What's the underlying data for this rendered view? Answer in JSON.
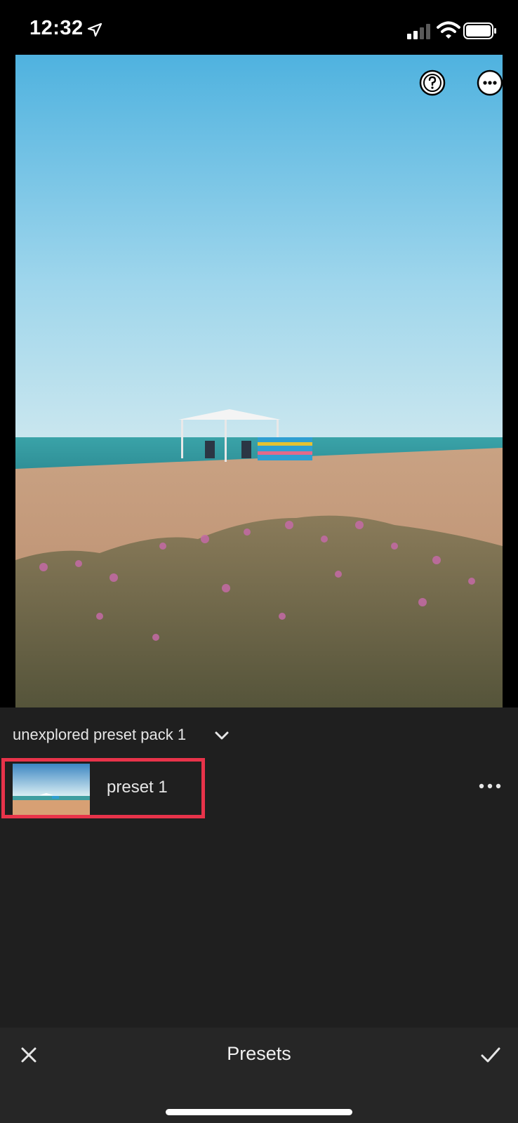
{
  "status_bar": {
    "time": "12:32",
    "icons": [
      "location-arrow-icon",
      "cellular-signal-icon",
      "wifi-icon",
      "battery-icon"
    ]
  },
  "photo_toolbar": {
    "icons": [
      "help-icon",
      "more-options-icon"
    ]
  },
  "preset_pack": {
    "title": "unexplored preset pack 1",
    "dropdown_icon": "chevron-down-icon"
  },
  "presets": [
    {
      "name": "preset 1",
      "highlighted": true,
      "highlight_color": "#e8334a"
    }
  ],
  "bottom_bar": {
    "title": "Presets",
    "close_icon": "close-icon",
    "confirm_icon": "checkmark-icon"
  },
  "colors": {
    "panel_bg": "#1f1f1f",
    "bottom_bar_bg": "#262626",
    "highlight": "#e8334a"
  }
}
